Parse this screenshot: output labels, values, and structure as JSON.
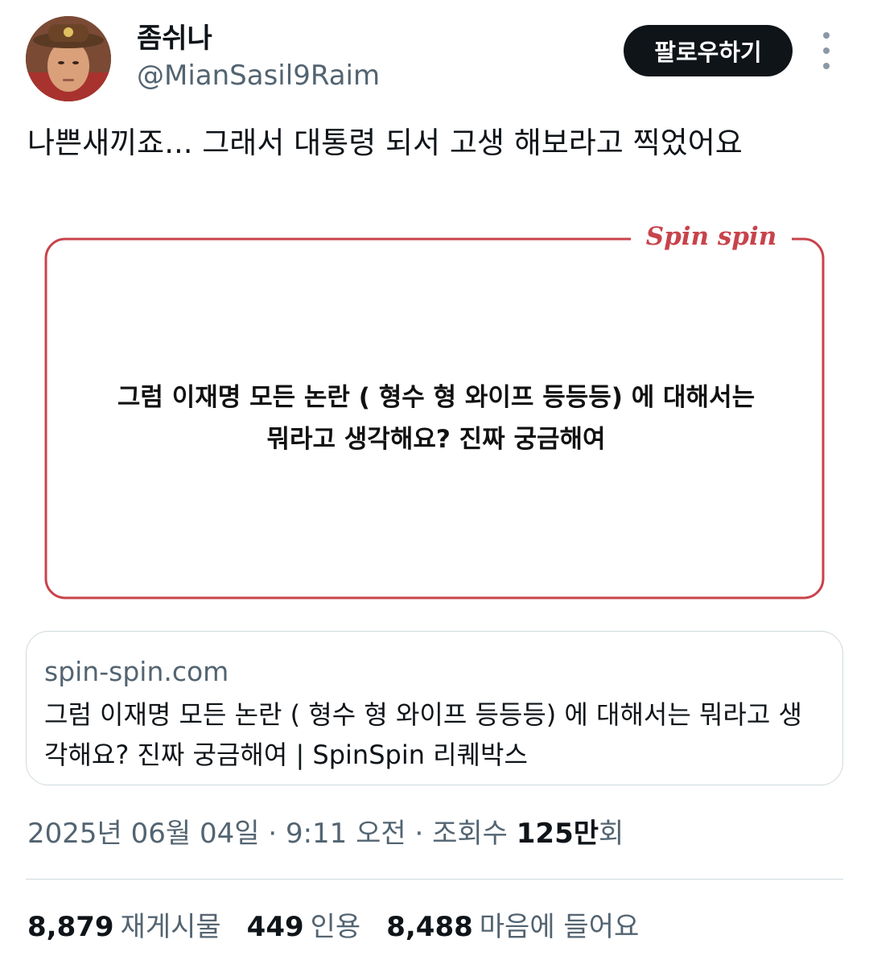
{
  "author": {
    "display_name": "좀쉬나",
    "handle": "@MianSasil9Raim",
    "avatar_icon": "profile-photo"
  },
  "actions": {
    "follow_label": "팔로우하기",
    "more_icon": "vertical-ellipsis-icon"
  },
  "tweet": {
    "text": "나쁜새끼죠... 그래서 대통령 되서 고생 해보라고 찍었어요"
  },
  "media": {
    "brand": "Spin spin",
    "question_line1": "그럼 이재명 모든 논란 ( 형수 형 와이프 등등등) 에 대해서는",
    "question_line2": "뭐라고 생각해요? 진짜 궁금해여",
    "frame_color": "#c8434b"
  },
  "link_card": {
    "domain": "spin-spin.com",
    "title": "그럼 이재명 모든 논란 ( 형수 형 와이프 등등등) 에 대해서는 뭐라고 생각해요? 진짜 궁금해여 | SpinSpin 리퀘박스"
  },
  "meta": {
    "date": "2025년 06월 04일",
    "time": "9:11 오전",
    "views_label": "조회수",
    "views_count": "125만",
    "views_unit": "회",
    "separator": " · "
  },
  "stats": [
    {
      "count": "8,879",
      "label": "재게시물"
    },
    {
      "count": "449",
      "label": "인용"
    },
    {
      "count": "8,488",
      "label": "마음에 들어요"
    }
  ]
}
